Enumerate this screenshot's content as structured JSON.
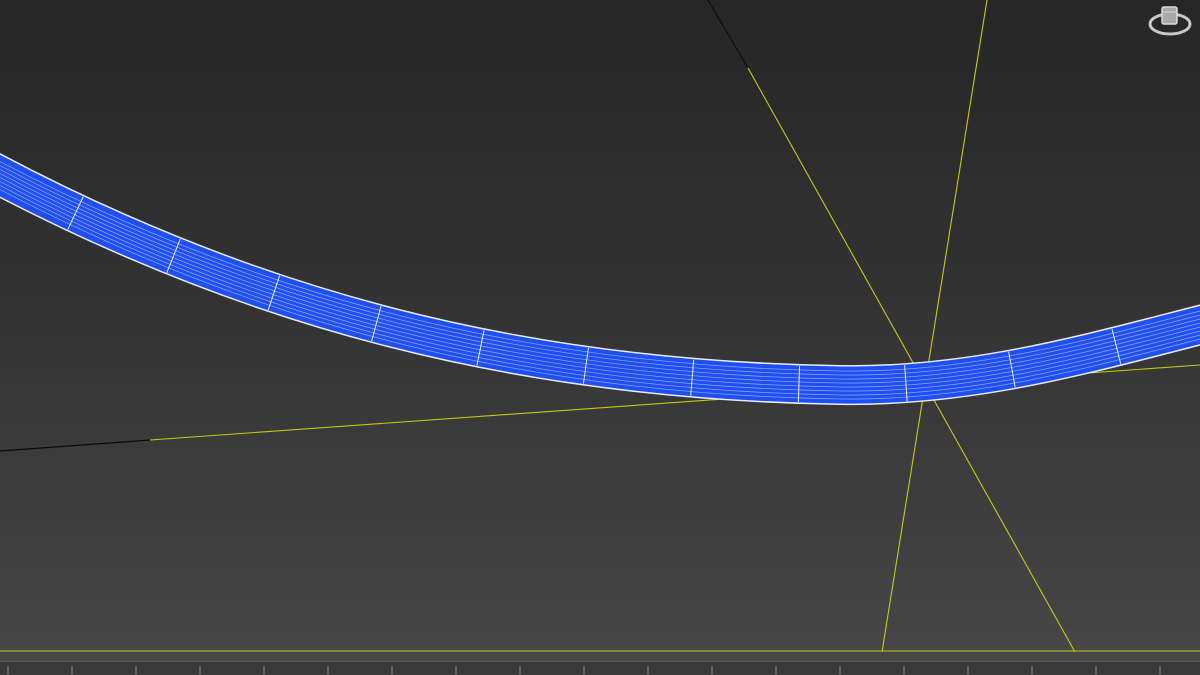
{
  "viewport": {
    "background_top": "#262626",
    "background_bottom": "#474747"
  },
  "colors": {
    "spline_fill": "#1f4ff0",
    "spline_wire": "#dfe6ff",
    "grid_axis": "#c8c816",
    "black_axis": "#0d0d0d",
    "timeline": "#3a3a3a"
  },
  "icons": {
    "viewcube": "viewcube-icon"
  }
}
